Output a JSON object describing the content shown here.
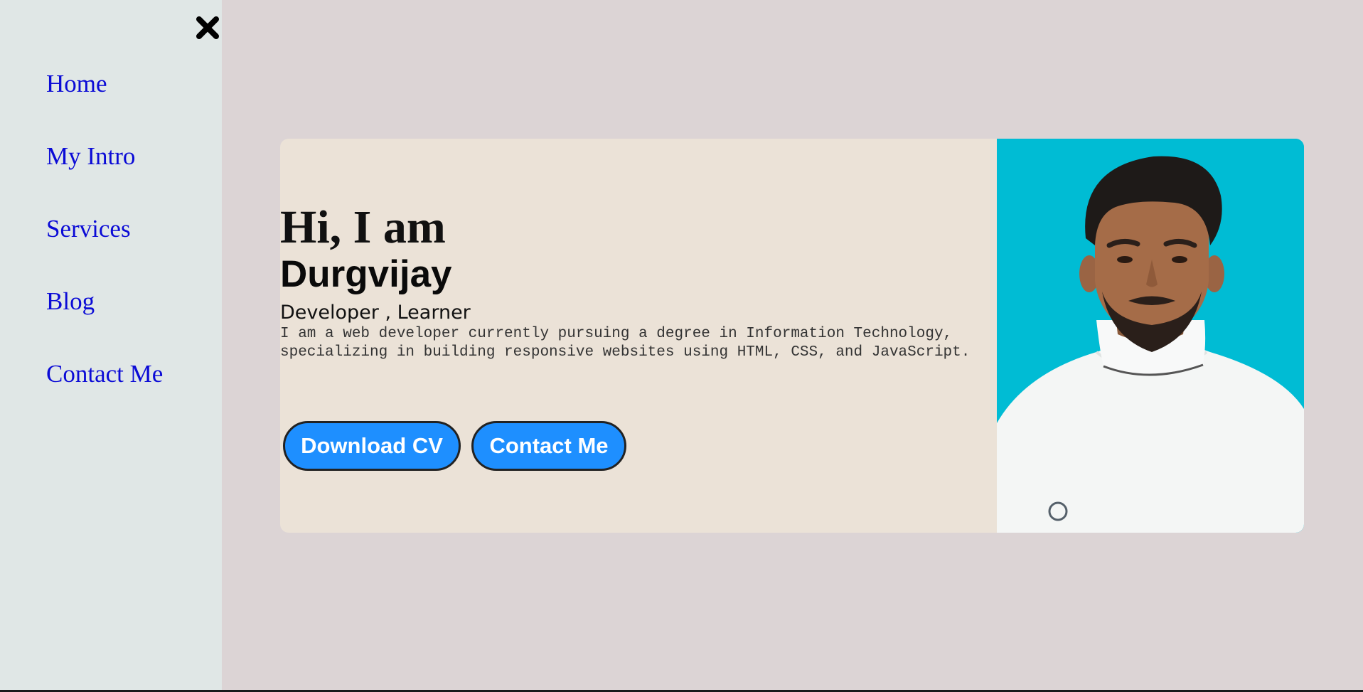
{
  "sidebar": {
    "close_icon": "close-icon",
    "items": [
      {
        "label": "Home"
      },
      {
        "label": "My Intro"
      },
      {
        "label": "Services"
      },
      {
        "label": "Blog"
      },
      {
        "label": "Contact Me"
      }
    ]
  },
  "hero": {
    "greeting": "Hi, I am",
    "name": "Durgvijay",
    "role": "Developer , Learner",
    "description": "I am a web developer currently pursuing a degree in Information Technology, specializing in building responsive websites using HTML, CSS, and JavaScript.",
    "buttons": {
      "download_cv": "Download CV",
      "contact_me": "Contact Me"
    }
  },
  "colors": {
    "page_background": "#dcd4d5",
    "sidebar_background": "#e0e7e6",
    "nav_link": "#0b0bd6",
    "card_background": "#ebe2d7",
    "photo_background": "#00bcd4",
    "button_background": "#1e8fff"
  }
}
